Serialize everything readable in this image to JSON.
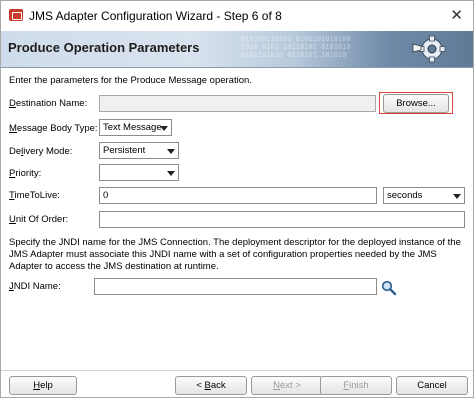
{
  "window": {
    "title": "JMS Adapter Configuration Wizard - Step 6 of 8"
  },
  "banner": {
    "title": "Produce Operation Parameters",
    "bits": "010100110101 0101101010100\n1010 0101 10110101 0101010\n0101101010 0110101 101010"
  },
  "intro": "Enter the parameters for the Produce Message operation.",
  "fields": {
    "destination_name": {
      "label_pre": "",
      "label_u": "D",
      "label_post": "estination Name:",
      "value": ""
    },
    "browse": {
      "label": "Browse..."
    },
    "message_body_type": {
      "label_pre": "",
      "label_u": "M",
      "label_post": "essage Body Type:",
      "value": "Text Message"
    },
    "delivery_mode": {
      "label_pre": "De",
      "label_u": "l",
      "label_post": "ivery Mode:",
      "value": "Persistent"
    },
    "priority": {
      "label_pre": "",
      "label_u": "P",
      "label_post": "riority:",
      "value": ""
    },
    "time_to_live": {
      "label_pre": "",
      "label_u": "T",
      "label_post": "imeToLive:",
      "value": "0",
      "unit": "seconds"
    },
    "unit_of_order": {
      "label_pre": "",
      "label_u": "U",
      "label_post": "nit Of Order:",
      "value": ""
    },
    "jndi_name": {
      "label_pre": "",
      "label_u": "J",
      "label_post": "NDI Name:",
      "value": ""
    }
  },
  "description": "Specify the JNDI name for the JMS Connection.  The deployment descriptor for the deployed instance of the JMS Adapter must associate this JNDI name with a set of configuration properties needed by the JMS Adapter to access the JMS destination at runtime.",
  "buttons": {
    "help": {
      "pre": "",
      "u": "H",
      "post": "elp"
    },
    "back": {
      "pre": "< ",
      "u": "B",
      "post": "ack"
    },
    "next": {
      "pre": "",
      "u": "N",
      "post": "ext >"
    },
    "finish": {
      "pre": "",
      "u": "F",
      "post": "inish"
    },
    "cancel": {
      "label": "Cancel"
    }
  },
  "colors": {
    "highlight": "#d9433f",
    "banner_dark": "#5f7a97",
    "banner_light": "#cfdceb"
  },
  "icons": {
    "app": "app-icon",
    "close": "close-icon",
    "gear": "gear-icon",
    "search": "search-icon"
  }
}
